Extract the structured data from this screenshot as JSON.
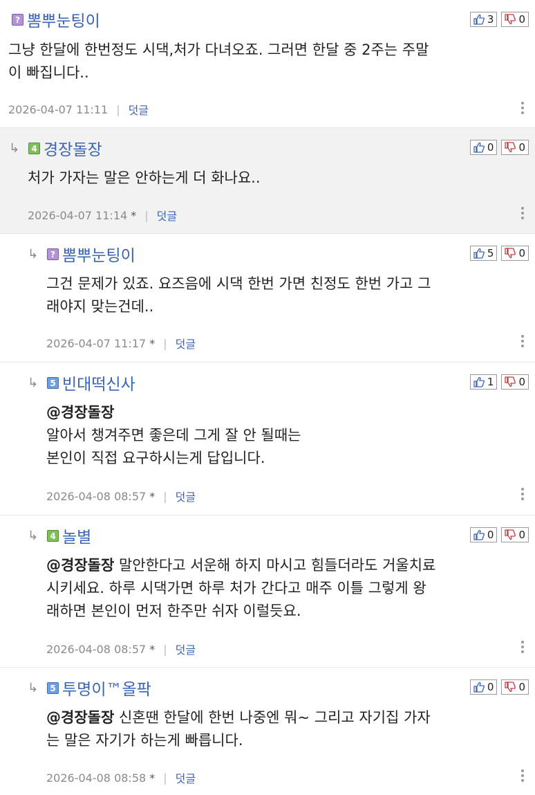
{
  "comments": [
    {
      "nick": "뽐뿌눈팅이",
      "level": "?",
      "up": "3",
      "down": "0",
      "lines": [
        "그냥 한달에 한번정도 시댁,처가 다녀오죠. 그러면 한달 중 2주는 주말",
        "이 빠집니다.."
      ],
      "mention": "",
      "date": "2026-04-07 11:11",
      "star": "",
      "reply": "덧글"
    },
    {
      "nick": "경장돌장",
      "level": "4",
      "up": "0",
      "down": "0",
      "lines": [
        "처가 가자는 말은 안하는게 더 화나요.."
      ],
      "mention": "",
      "date": "2026-04-07 11:14",
      "star": "*",
      "reply": "덧글"
    },
    {
      "nick": "뽐뿌눈팅이",
      "level": "?",
      "up": "5",
      "down": "0",
      "lines": [
        "그건 문제가 있죠. 요즈음에 시댁 한번 가면 친정도 한번 가고 그",
        "래야지 맞는건데.."
      ],
      "mention": "",
      "date": "2026-04-07 11:17",
      "star": "*",
      "reply": "덧글"
    },
    {
      "nick": "빈대떡신사",
      "level": "5",
      "up": "1",
      "down": "0",
      "lines": [
        "",
        "알아서 챙겨주면 좋은데 그게 잘 안 될때는",
        "본인이 직접 요구하시는게 답입니다."
      ],
      "mention": "@경장돌장",
      "date": "2026-04-08 08:57",
      "star": "*",
      "reply": "덧글"
    },
    {
      "nick": "놀별",
      "level": "4",
      "up": "0",
      "down": "0",
      "lines": [
        " 말안한다고 서운해 하지 마시고 힘들더라도 거울치료",
        "시키세요. 하루 시댁가면 하루 처가 간다고 매주 이틀 그렇게 왕",
        "래하면 본인이 먼저 한주만 쉬자 이럴듯요."
      ],
      "mention": "@경장돌장",
      "date": "2026-04-08 08:57",
      "star": "*",
      "reply": "덧글"
    },
    {
      "nick": "투명이™올팍",
      "level": "5",
      "up": "0",
      "down": "0",
      "lines": [
        " 신혼땐 한달에 한번 나중엔 뭐~ 그리고 자기집 가자",
        "는 말은 자기가 하는게 빠릅니다."
      ],
      "mention": "@경장돌장",
      "date": "2026-04-08 08:58",
      "star": "*",
      "reply": "덧글"
    }
  ]
}
